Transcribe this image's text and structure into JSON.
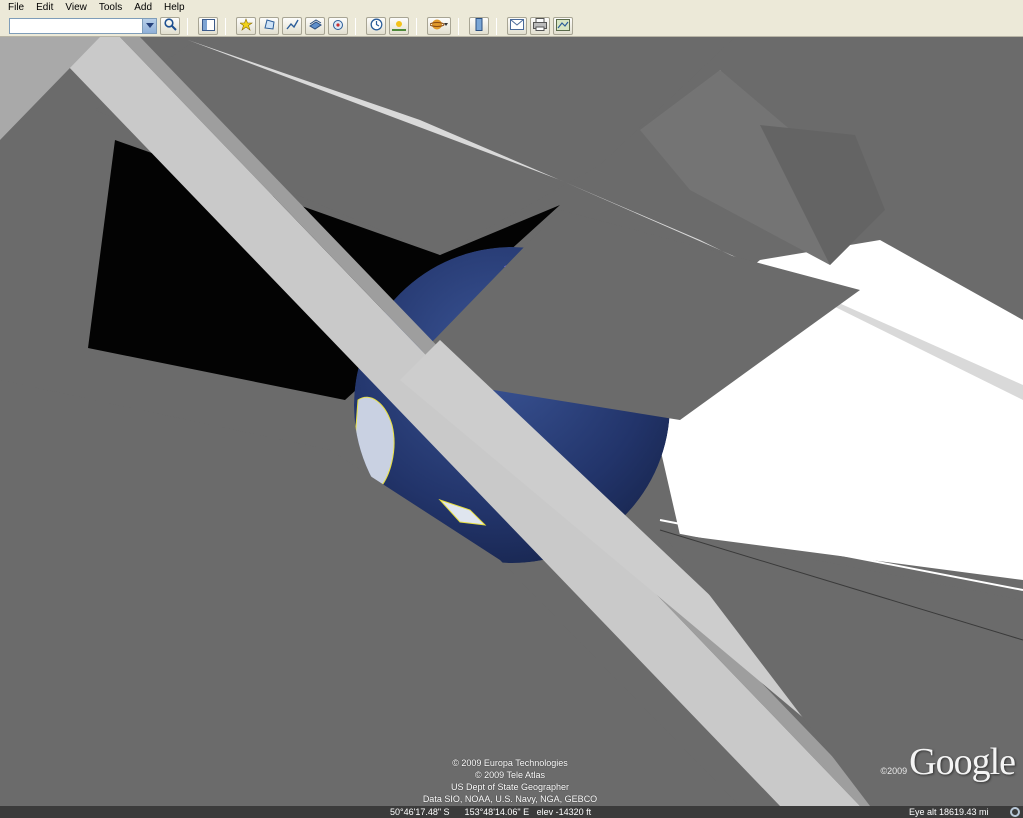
{
  "menu": {
    "items": [
      "File",
      "Edit",
      "View",
      "Tools",
      "Add",
      "Help"
    ]
  },
  "search": {
    "value": ""
  },
  "toolbar": {
    "icons": [
      "search-icon",
      "sidebar-toggle-icon",
      "placemark-icon",
      "polygon-icon",
      "path-icon",
      "image-overlay-icon",
      "record-tour-icon",
      "historical-imagery-icon",
      "sunlight-icon",
      "planets-icon",
      "ruler-icon",
      "email-icon",
      "print-icon",
      "view-in-maps-icon"
    ]
  },
  "attribution": {
    "lines": [
      "© 2009 Europa Technologies",
      "© 2009 Tele Atlas",
      "US Dept of State Geographer",
      "Data SIO, NOAA, U.S. Navy, NGA, GEBCO"
    ]
  },
  "logo": {
    "year": "©2009",
    "word": "Google"
  },
  "status": {
    "coordinates": "50°46'17.48\" S      153°48'14.06\" E   elev -14320 ft",
    "eye_alt": "Eye alt 18619.43 mi"
  },
  "colors": {
    "chrome": "#ece9d8",
    "ocean": "#22346a",
    "coastline": "#e8e040",
    "wall_dark": "#6b6b6b",
    "wall_light": "#cfcfcf"
  }
}
